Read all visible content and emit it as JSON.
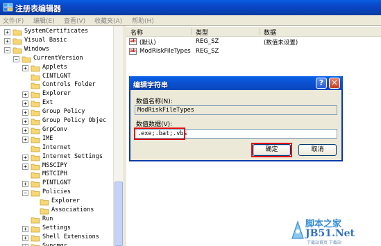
{
  "window": {
    "title": "注册表编辑器"
  },
  "menu": [
    {
      "label": "文件(F)"
    },
    {
      "label": "编辑(E)"
    },
    {
      "label": "查看(V)"
    },
    {
      "label": "收藏夹(A)"
    },
    {
      "label": "帮助(H)"
    }
  ],
  "tree": {
    "items": [
      {
        "label": "SystemCertificates",
        "expander": "+"
      },
      {
        "label": "Visual Basic",
        "expander": "+"
      },
      {
        "label": "Windows",
        "expander": "−"
      },
      {
        "label": "CurrentVersion",
        "expander": "−"
      },
      {
        "label": "Applets",
        "expander": "+"
      },
      {
        "label": "CINTLGNT",
        "expander": ""
      },
      {
        "label": "Controls Folder",
        "expander": ""
      },
      {
        "label": "Explorer",
        "expander": "+"
      },
      {
        "label": "Ext",
        "expander": "+"
      },
      {
        "label": "Group Policy",
        "expander": "+"
      },
      {
        "label": "Group Policy Objec",
        "expander": "+"
      },
      {
        "label": "GrpConv",
        "expander": "+"
      },
      {
        "label": "IME",
        "expander": "+"
      },
      {
        "label": "Internet",
        "expander": ""
      },
      {
        "label": "Internet Settings",
        "expander": "+"
      },
      {
        "label": "MSSCIPY",
        "expander": "+"
      },
      {
        "label": "MSTCIPH",
        "expander": ""
      },
      {
        "label": "PINTLGNT",
        "expander": "+"
      },
      {
        "label": "Policies",
        "expander": "−"
      },
      {
        "label": "Explorer",
        "expander": ""
      },
      {
        "label": "Associations",
        "expander": ""
      },
      {
        "label": "Run",
        "expander": ""
      },
      {
        "label": "Settings",
        "expander": "+"
      },
      {
        "label": "Shell Extensions",
        "expander": "+"
      },
      {
        "label": "Syncmgr",
        "expander": "+"
      }
    ]
  },
  "list": {
    "columns": {
      "name": "名称",
      "type": "类型",
      "data": "数据"
    },
    "rows": [
      {
        "name": "(默认)",
        "type": "REG_SZ",
        "data": "(数值未设置)"
      },
      {
        "name": "ModRiskFileTypes",
        "type": "REG_SZ",
        "data": ""
      }
    ]
  },
  "dialog": {
    "title": "编辑字符串",
    "help_glyph": "?",
    "close_glyph": "✕",
    "name_label": "数值名称(N):",
    "name_value": "ModRiskFileTypes",
    "data_label": "数值数据(V):",
    "data_value": ".exe;.bat;.vbs",
    "ok_label": "确定",
    "cancel_label": "取消"
  },
  "watermark": {
    "line1": "脚本之家",
    "line2": "JB51.Net",
    "line3": "下载站首页 下载站"
  },
  "colors": {
    "highlight_border": "#e01010",
    "titlebar": "#0a46c8"
  }
}
